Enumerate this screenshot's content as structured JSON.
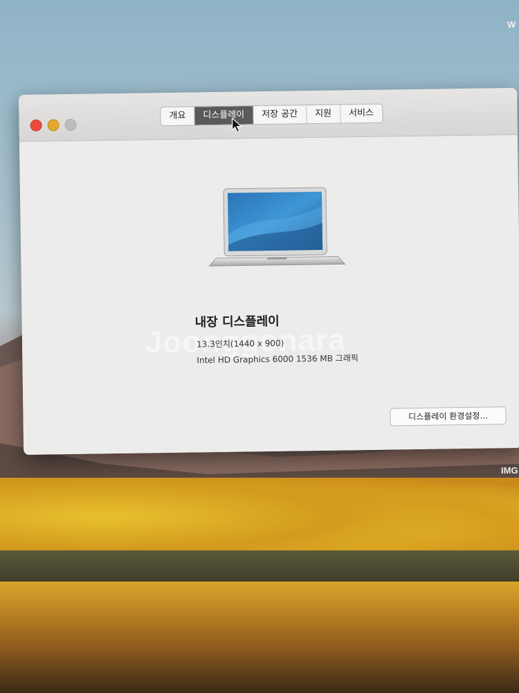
{
  "window": {
    "tabs": [
      {
        "label": "개요"
      },
      {
        "label": "디스플레이",
        "active": true
      },
      {
        "label": "저장 공간"
      },
      {
        "label": "지원"
      },
      {
        "label": "서비스"
      }
    ]
  },
  "display": {
    "title": "내장 디스플레이",
    "resolution": "13.3인치(1440 x 900)",
    "graphics": "Intel HD Graphics 6000 1536 MB 그래픽",
    "settings_button": "디스플레이 환경설정..."
  },
  "overlay": {
    "watermark": "Joonggonara",
    "edge_top": "W",
    "edge_right": "IMG"
  },
  "colors": {
    "close": "#ec4c40",
    "minimize": "#e2a92c",
    "zoom": "#bdbcba",
    "active_tab": "#5a5a5a"
  }
}
